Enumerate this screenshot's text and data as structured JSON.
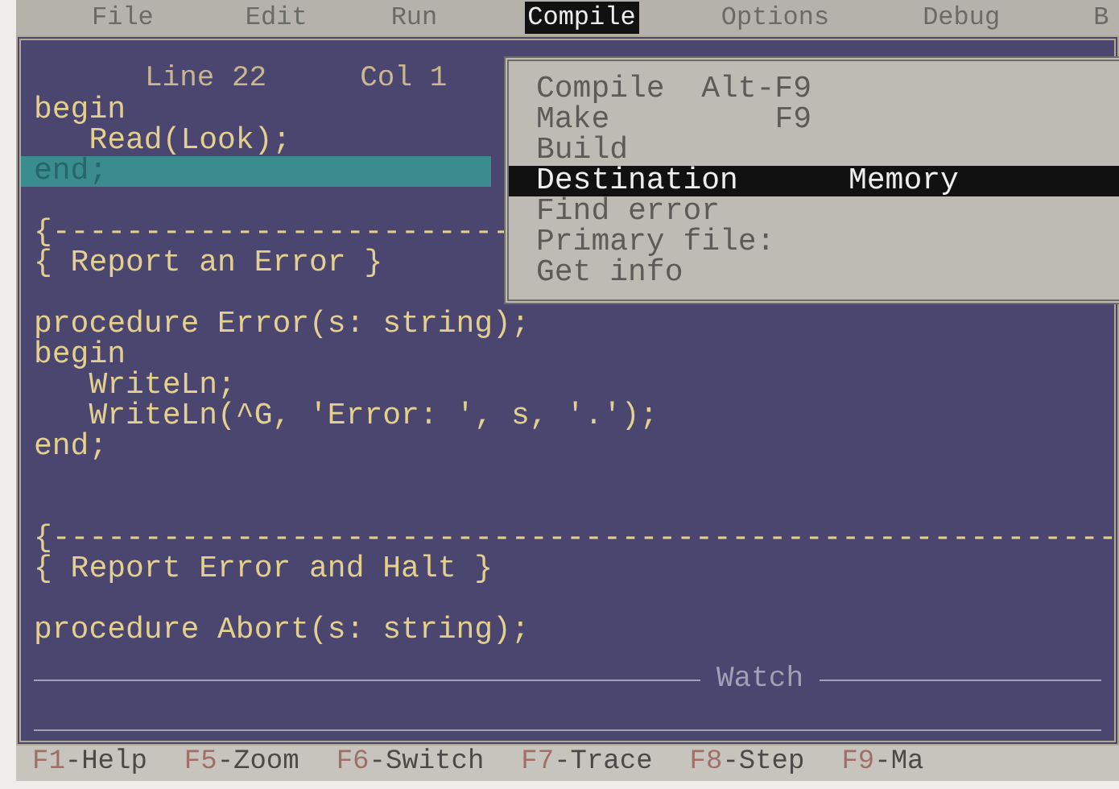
{
  "menu_bar": [
    {
      "label": "File",
      "selected": false
    },
    {
      "label": "Edit",
      "selected": false
    },
    {
      "label": "Run",
      "selected": false
    },
    {
      "label": "Compile",
      "selected": true
    },
    {
      "label": "Options",
      "selected": false
    },
    {
      "label": "Debug",
      "selected": false
    },
    {
      "label": "B",
      "selected": false
    }
  ],
  "editor": {
    "line": "Line 22",
    "col": "Col 1",
    "lines": [
      {
        "text": "begin",
        "selected": false
      },
      {
        "text": "   Read(Look);",
        "selected": false
      },
      {
        "text": "end;",
        "selected": true
      },
      {
        "kind": "blank"
      },
      {
        "text": "{-------------------------",
        "selected": false
      },
      {
        "text": "{ Report an Error }",
        "selected": false
      },
      {
        "kind": "blank"
      },
      {
        "text": "procedure Error(s: string);",
        "selected": false
      },
      {
        "text": "begin",
        "selected": false
      },
      {
        "text": "   WriteLn;",
        "selected": false
      },
      {
        "text": "   WriteLn(^G, 'Error: ', s, '.');",
        "selected": false
      },
      {
        "text": "end;",
        "selected": false
      },
      {
        "kind": "blank"
      },
      {
        "kind": "blank"
      },
      {
        "text": "{----------------------------------------------------------",
        "selected": false
      },
      {
        "text": "{ Report Error and Halt }",
        "selected": false
      },
      {
        "kind": "blank"
      },
      {
        "text": "procedure Abort(s: string);",
        "selected": false
      }
    ]
  },
  "compile_menu": [
    {
      "kind": "shortcut",
      "label": "Compile",
      "value": "Alt-F9",
      "selected": false
    },
    {
      "kind": "shortcut",
      "label": "Make",
      "value": "F9",
      "selected": false
    },
    {
      "kind": "plain",
      "label": "Build",
      "selected": false
    },
    {
      "kind": "setting",
      "label": "Destination",
      "value": "Memory",
      "selected": true
    },
    {
      "kind": "plain",
      "label": "Find error",
      "selected": false
    },
    {
      "kind": "plain",
      "label": "Primary file:",
      "selected": false
    },
    {
      "kind": "plain",
      "label": "Get info",
      "selected": false
    }
  ],
  "watch": {
    "title": "Watch"
  },
  "status_bar": [
    {
      "key": "F1",
      "label": "-Help"
    },
    {
      "key": "F5",
      "label": "-Zoom"
    },
    {
      "key": "F6",
      "label": "-Switch"
    },
    {
      "key": "F7",
      "label": "-Trace"
    },
    {
      "key": "F8",
      "label": "-Step"
    },
    {
      "key": "F9",
      "label": "-Ma"
    }
  ]
}
